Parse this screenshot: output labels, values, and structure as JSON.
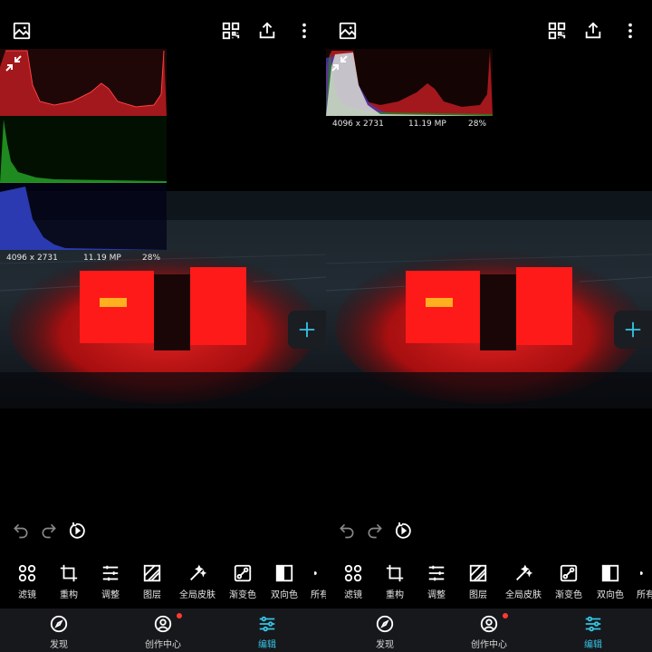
{
  "colors": {
    "accent": "#35c4e4",
    "background": "#000000",
    "nav_background": "#17181c",
    "notification": "#ff3b30"
  },
  "toolbar": {
    "icons": [
      "image-icon",
      "qr-code-icon",
      "share-upload-icon",
      "more-vert-icon"
    ]
  },
  "add_button": {
    "icon": "plus-icon"
  },
  "history": {
    "icons": [
      "undo-icon",
      "redo-icon",
      "reset-icon"
    ]
  },
  "panes": [
    {
      "histogram": {
        "mode": "separate",
        "channels": [
          "red",
          "green",
          "blue"
        ],
        "dimensions": "4096 x 2731",
        "megapixels": "11.19 MP",
        "zoom": "28%"
      },
      "tools": [
        {
          "label": "滤镜",
          "icon": "filter-grid-icon"
        },
        {
          "label": "重构",
          "icon": "crop-icon"
        },
        {
          "label": "调整",
          "icon": "sliders-icon"
        },
        {
          "label": "图层",
          "icon": "layers-icon"
        },
        {
          "label": "全局皮肤",
          "icon": "magic-wand-icon"
        },
        {
          "label": "渐变色",
          "icon": "gradient-icon"
        },
        {
          "label": "双向色",
          "icon": "dual-tone-icon"
        },
        {
          "label": "所有",
          "icon": "dot-icon"
        }
      ],
      "nav": [
        {
          "label": "发现",
          "icon": "compass-icon",
          "active": false
        },
        {
          "label": "创作中心",
          "icon": "person-circle-icon",
          "active": false,
          "badge": true
        },
        {
          "label": "编辑",
          "icon": "edit-sliders-icon",
          "active": true
        }
      ]
    },
    {
      "histogram": {
        "mode": "combined",
        "channels": [
          "red",
          "green",
          "blue",
          "luminance"
        ],
        "dimensions": "4096 x 2731",
        "megapixels": "11.19 MP",
        "zoom": "28%"
      },
      "tools": [
        {
          "label": "滤镜",
          "icon": "filter-grid-icon"
        },
        {
          "label": "重构",
          "icon": "crop-icon"
        },
        {
          "label": "调整",
          "icon": "sliders-icon"
        },
        {
          "label": "图层",
          "icon": "layers-icon"
        },
        {
          "label": "全局皮肤",
          "icon": "magic-wand-icon"
        },
        {
          "label": "渐变色",
          "icon": "gradient-icon"
        },
        {
          "label": "双向色",
          "icon": "dual-tone-icon"
        },
        {
          "label": "所有",
          "icon": "dot-icon"
        }
      ],
      "nav": [
        {
          "label": "发现",
          "icon": "compass-icon",
          "active": false
        },
        {
          "label": "创作中心",
          "icon": "person-circle-icon",
          "active": false,
          "badge": true
        },
        {
          "label": "编辑",
          "icon": "edit-sliders-icon",
          "active": true
        }
      ]
    }
  ]
}
